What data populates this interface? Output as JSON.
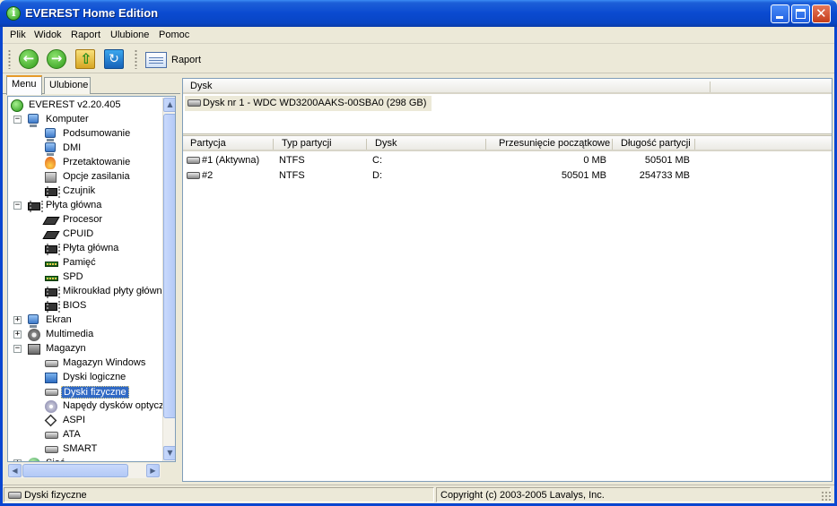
{
  "window": {
    "title": "EVEREST Home Edition"
  },
  "menu": [
    "Plik",
    "Widok",
    "Raport",
    "Ulubione",
    "Pomoc"
  ],
  "toolbar": {
    "report_label": "Raport"
  },
  "left_tabs": [
    "Menu",
    "Ulubione"
  ],
  "tree": [
    {
      "label": "EVEREST v2.20.405",
      "icon": "info-icon",
      "level": 0
    },
    {
      "label": "Komputer",
      "icon": "computer-icon",
      "level": 1,
      "expander": "−"
    },
    {
      "label": "Podsumowanie",
      "icon": "computer-icon",
      "level": 2
    },
    {
      "label": "DMI",
      "icon": "computer-icon",
      "level": 2
    },
    {
      "label": "Przetaktowanie",
      "icon": "fire-icon",
      "level": 2
    },
    {
      "label": "Opcje zasilania",
      "icon": "power-icon",
      "level": 2
    },
    {
      "label": "Czujnik",
      "icon": "chip-icon",
      "level": 2
    },
    {
      "label": "Płyta główna",
      "icon": "motherboard-icon",
      "level": 1,
      "expander": "−"
    },
    {
      "label": "Procesor",
      "icon": "cpu-icon",
      "level": 2
    },
    {
      "label": "CPUID",
      "icon": "cpu-icon",
      "level": 2
    },
    {
      "label": "Płyta główna",
      "icon": "motherboard-icon",
      "level": 2
    },
    {
      "label": "Pamięć",
      "icon": "ram-icon",
      "level": 2
    },
    {
      "label": "SPD",
      "icon": "ram-icon",
      "level": 2
    },
    {
      "label": "Mikroukład płyty główn",
      "icon": "chip-icon",
      "level": 2
    },
    {
      "label": "BIOS",
      "icon": "chip-icon",
      "level": 2
    },
    {
      "label": "Ekran",
      "icon": "computer-icon",
      "level": 1,
      "expander": "+"
    },
    {
      "label": "Multimedia",
      "icon": "speaker-icon",
      "level": 1,
      "expander": "+"
    },
    {
      "label": "Magazyn",
      "icon": "drives-icon",
      "level": 1,
      "expander": "−"
    },
    {
      "label": "Magazyn Windows",
      "icon": "disk-icon",
      "level": 2
    },
    {
      "label": "Dyski logiczne",
      "icon": "window-icon",
      "level": 2
    },
    {
      "label": "Dyski fizyczne",
      "icon": "disk-icon",
      "level": 2,
      "selected": true
    },
    {
      "label": "Napędy dysków optycz",
      "icon": "cd-icon",
      "level": 2
    },
    {
      "label": "ASPI",
      "icon": "aspi-icon",
      "level": 2
    },
    {
      "label": "ATA",
      "icon": "disk-icon",
      "level": 2
    },
    {
      "label": "SMART",
      "icon": "disk-icon",
      "level": 2
    },
    {
      "label": "Sieć",
      "icon": "globe-icon",
      "level": 1,
      "expander": "+"
    }
  ],
  "disk_panel": {
    "header": "Dysk",
    "item": "Dysk nr 1 - WDC WD3200AAKS-00SBA0 (298 GB)"
  },
  "partitions": {
    "columns": [
      "Partycja",
      "Typ partycji",
      "Dysk",
      "Przesunięcie początkowe",
      "Długość partycji"
    ],
    "rows": [
      [
        "#1 (Aktywna)",
        "NTFS",
        "C:",
        "0 MB",
        "50501 MB"
      ],
      [
        "#2",
        "NTFS",
        "D:",
        "50501 MB",
        "254733 MB"
      ]
    ]
  },
  "status": {
    "left": "Dyski fizyczne",
    "right": "Copyright (c) 2003-2005 Lavalys, Inc."
  }
}
